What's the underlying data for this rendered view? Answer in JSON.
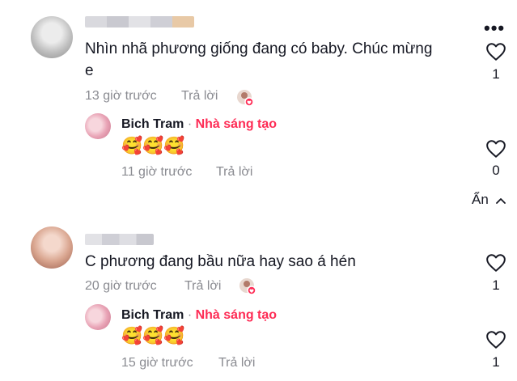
{
  "comments": [
    {
      "text_line1": "Nhìn nhã phương giống đang có baby. Chúc mừng",
      "text_line2": "e",
      "time": "13 giờ trước",
      "reply_label": "Trả lời",
      "likes": "1",
      "reply": {
        "author": "Bich Tram",
        "separator": "·",
        "badge": "Nhà sáng tạo",
        "emoji": "🥰🥰🥰",
        "time": "11 giờ trước",
        "reply_label": "Trả lời",
        "likes": "0"
      }
    },
    {
      "text_line1": "C phương đang bầu nữa hay sao á hén",
      "time": "20 giờ trước",
      "reply_label": "Trả lời",
      "likes": "1",
      "reply": {
        "author": "Bich Tram",
        "separator": "·",
        "badge": "Nhà sáng tạo",
        "emoji": "🥰🥰🥰",
        "time": "15 giờ trước",
        "reply_label": "Trả lời",
        "likes": "1"
      }
    }
  ],
  "hide_label": "Ẩn",
  "more_label": "•••",
  "colors": {
    "accent": "#fe2c55",
    "meta": "#8a8b91",
    "text": "#161823"
  },
  "icons": [
    "more-options-icon",
    "heart-icon",
    "chevron-up-icon",
    "creator-liked-icon"
  ]
}
